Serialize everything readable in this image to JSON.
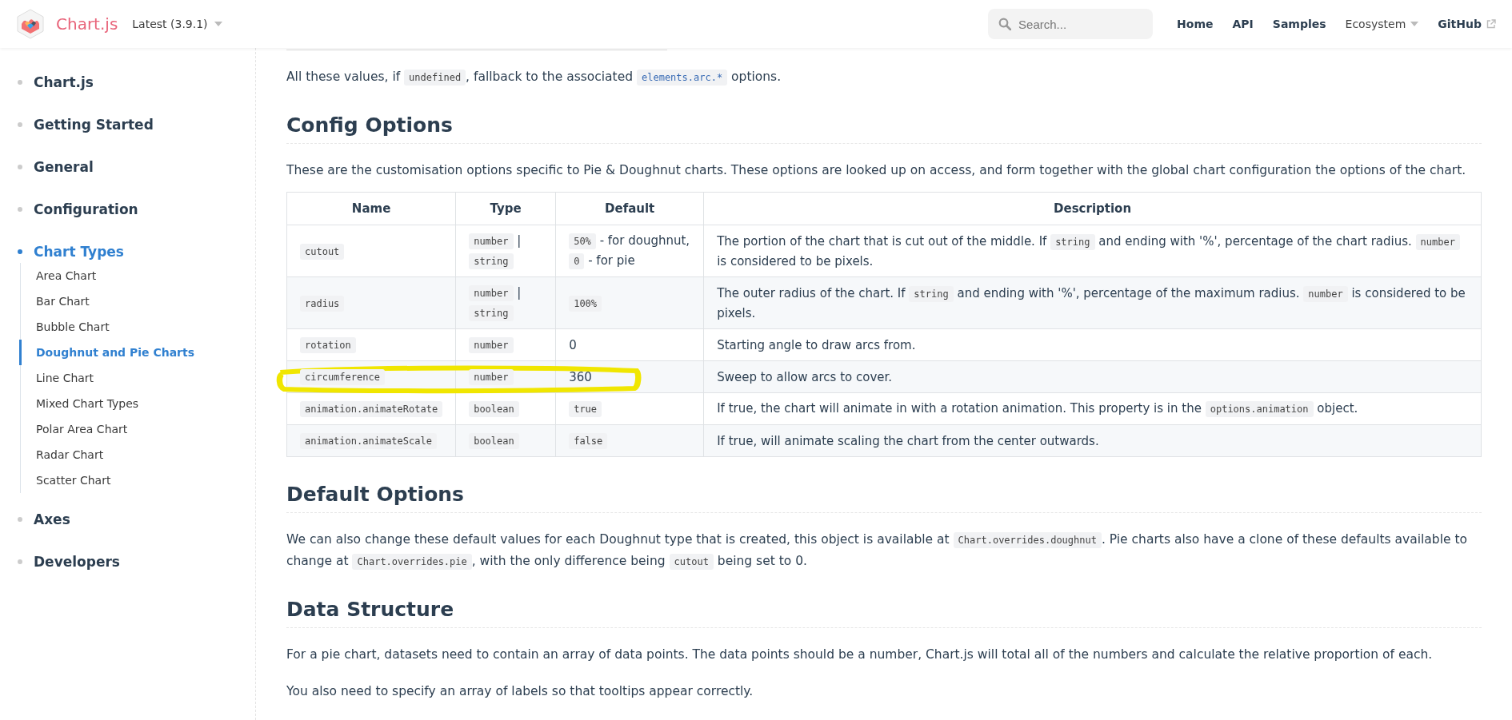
{
  "header": {
    "logo_text": "Chart.js",
    "version": "Latest (3.9.1)",
    "search": {
      "placeholder": "Search..."
    },
    "nav": [
      {
        "label": "Home",
        "kind": "link"
      },
      {
        "label": "API",
        "kind": "link"
      },
      {
        "label": "Samples",
        "kind": "link"
      },
      {
        "label": "Ecosystem",
        "kind": "dropdown"
      },
      {
        "label": "GitHub",
        "kind": "external"
      }
    ]
  },
  "sidebar": {
    "items": [
      {
        "label": "Chart.js",
        "selected": false
      },
      {
        "label": "Getting Started",
        "selected": false
      },
      {
        "label": "General",
        "selected": false
      },
      {
        "label": "Configuration",
        "selected": false
      },
      {
        "label": "Chart Types",
        "selected": true,
        "children": [
          {
            "label": "Area Chart",
            "selected": false
          },
          {
            "label": "Bar Chart",
            "selected": false
          },
          {
            "label": "Bubble Chart",
            "selected": false
          },
          {
            "label": "Doughnut and Pie Charts",
            "selected": true
          },
          {
            "label": "Line Chart",
            "selected": false
          },
          {
            "label": "Mixed Chart Types",
            "selected": false
          },
          {
            "label": "Polar Area Chart",
            "selected": false
          },
          {
            "label": "Radar Chart",
            "selected": false
          },
          {
            "label": "Scatter Chart",
            "selected": false
          }
        ]
      },
      {
        "label": "Axes",
        "selected": false
      },
      {
        "label": "Developers",
        "selected": false
      }
    ]
  },
  "content": [
    {
      "kind": "paragraph",
      "segments": [
        {
          "kind": "text",
          "text": "All these values, if "
        },
        {
          "kind": "code",
          "text": "undefined"
        },
        {
          "kind": "text",
          "text": ", fallback to the associated "
        },
        {
          "kind": "codelink",
          "text": "elements.arc.*"
        },
        {
          "kind": "text",
          "text": " options."
        }
      ]
    },
    {
      "kind": "heading",
      "text": "Config Options"
    },
    {
      "kind": "paragraph",
      "segments": [
        {
          "kind": "text",
          "text": "These are the customisation options specific to Pie & Doughnut charts. These options are looked up on access, and form together with the global chart configuration the options of the chart."
        }
      ]
    },
    {
      "kind": "table",
      "columns": [
        "Name",
        "Type",
        "Default",
        "Description"
      ],
      "rows": [
        {
          "highlighted": false,
          "cells": [
            [
              {
                "kind": "code",
                "text": "cutout"
              }
            ],
            [
              {
                "kind": "code",
                "text": "number"
              },
              {
                "kind": "text",
                "text": " | "
              },
              {
                "kind": "code",
                "text": "string"
              }
            ],
            [
              {
                "kind": "code",
                "text": "50%"
              },
              {
                "kind": "text",
                "text": " - for doughnut, "
              },
              {
                "kind": "code",
                "text": "0"
              },
              {
                "kind": "text",
                "text": " - for pie"
              }
            ],
            [
              {
                "kind": "text",
                "text": "The portion of the chart that is cut out of the middle. If "
              },
              {
                "kind": "code",
                "text": "string"
              },
              {
                "kind": "text",
                "text": " and ending with '%', percentage of the chart radius. "
              },
              {
                "kind": "code",
                "text": "number"
              },
              {
                "kind": "text",
                "text": " is considered to be pixels."
              }
            ]
          ]
        },
        {
          "highlighted": false,
          "cells": [
            [
              {
                "kind": "code",
                "text": "radius"
              }
            ],
            [
              {
                "kind": "code",
                "text": "number"
              },
              {
                "kind": "text",
                "text": " | "
              },
              {
                "kind": "code",
                "text": "string"
              }
            ],
            [
              {
                "kind": "code",
                "text": "100%"
              }
            ],
            [
              {
                "kind": "text",
                "text": "The outer radius of the chart. If "
              },
              {
                "kind": "code",
                "text": "string"
              },
              {
                "kind": "text",
                "text": " and ending with '%', percentage of the maximum radius. "
              },
              {
                "kind": "code",
                "text": "number"
              },
              {
                "kind": "text",
                "text": " is considered to be pixels."
              }
            ]
          ]
        },
        {
          "highlighted": false,
          "cells": [
            [
              {
                "kind": "code",
                "text": "rotation"
              }
            ],
            [
              {
                "kind": "code",
                "text": "number"
              }
            ],
            [
              {
                "kind": "text",
                "text": "0"
              }
            ],
            [
              {
                "kind": "text",
                "text": "Starting angle to draw arcs from."
              }
            ]
          ]
        },
        {
          "highlighted": true,
          "cells": [
            [
              {
                "kind": "code",
                "text": "circumference"
              }
            ],
            [
              {
                "kind": "code",
                "text": "number"
              }
            ],
            [
              {
                "kind": "text",
                "text": "360"
              }
            ],
            [
              {
                "kind": "text",
                "text": "Sweep to allow arcs to cover."
              }
            ]
          ]
        },
        {
          "highlighted": false,
          "cells": [
            [
              {
                "kind": "code",
                "text": "animation.animateRotate"
              }
            ],
            [
              {
                "kind": "code",
                "text": "boolean"
              }
            ],
            [
              {
                "kind": "code",
                "text": "true"
              }
            ],
            [
              {
                "kind": "text",
                "text": "If true, the chart will animate in with a rotation animation. This property is in the "
              },
              {
                "kind": "code",
                "text": "options.animation"
              },
              {
                "kind": "text",
                "text": " object."
              }
            ]
          ]
        },
        {
          "highlighted": false,
          "cells": [
            [
              {
                "kind": "code",
                "text": "animation.animateScale"
              }
            ],
            [
              {
                "kind": "code",
                "text": "boolean"
              }
            ],
            [
              {
                "kind": "code",
                "text": "false"
              }
            ],
            [
              {
                "kind": "text",
                "text": "If true, will animate scaling the chart from the center outwards."
              }
            ]
          ]
        }
      ]
    },
    {
      "kind": "heading",
      "text": "Default Options"
    },
    {
      "kind": "paragraph",
      "segments": [
        {
          "kind": "text",
          "text": "We can also change these default values for each Doughnut type that is created, this object is available at "
        },
        {
          "kind": "code",
          "text": "Chart.overrides.doughnut"
        },
        {
          "kind": "text",
          "text": ". Pie charts also have a clone of these defaults available to change at "
        },
        {
          "kind": "code",
          "text": "Chart.overrides.pie"
        },
        {
          "kind": "text",
          "text": ", with the only difference being "
        },
        {
          "kind": "code",
          "text": "cutout"
        },
        {
          "kind": "text",
          "text": " being set to 0."
        }
      ]
    },
    {
      "kind": "heading",
      "text": "Data Structure"
    },
    {
      "kind": "paragraph",
      "segments": [
        {
          "kind": "text",
          "text": "For a pie chart, datasets need to contain an array of data points. The data points should be a number, Chart.js will total all of the numbers and calculate the relative proportion of each."
        }
      ]
    },
    {
      "kind": "paragraph",
      "segments": [
        {
          "kind": "text",
          "text": "You also need to specify an array of labels so that tooltips appear correctly."
        }
      ]
    }
  ]
}
